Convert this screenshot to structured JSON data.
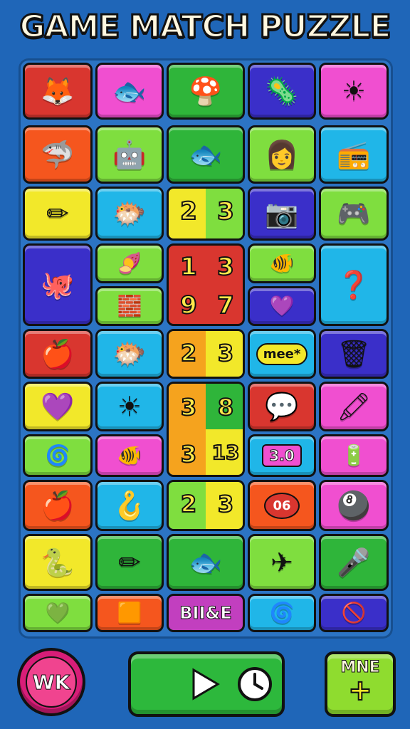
{
  "title": "GAME MATCH PUZZLE",
  "grid": {
    "tiles": [
      {
        "color": "#d9362f",
        "icon": "🦊",
        "name": "fox-icon"
      },
      {
        "color": "#f04fd0",
        "icon": "🐟",
        "name": "fish-icon"
      },
      {
        "color": "#2fb53a",
        "icon": "🍄",
        "name": "mushroom-icon"
      },
      {
        "color": "#3a2fc9",
        "icon": "🦠",
        "name": "blob-icon"
      },
      {
        "color": "#f04fd0",
        "icon": "☀",
        "name": "sun-icon"
      },
      {
        "color": "#f5561e",
        "icon": "🦈",
        "name": "shark-icon"
      },
      {
        "color": "#7fde3f",
        "icon": "🤖",
        "name": "robot-icon"
      },
      {
        "color": "#2fb53a",
        "icon": "🐟",
        "name": "fish-key-icon"
      },
      {
        "color": "#7fde3f",
        "icon": "👩",
        "name": "face-icon"
      },
      {
        "color": "#20b6e8",
        "icon": "📻",
        "name": "radio-icon"
      },
      {
        "color": "#f2e82a",
        "icon": "✏",
        "name": "pencil-icon"
      },
      {
        "color": "#20b6e8",
        "icon": "🐡",
        "name": "pufferfish-icon"
      },
      {
        "color": "#3a2fc9",
        "icon": "📷",
        "name": "camera-icon"
      },
      {
        "color": "#7fde3f",
        "icon": "🎮",
        "name": "gamepad-icon"
      },
      {
        "color": "#3a2fc9",
        "icon": "🐙",
        "name": "octopus-icon"
      },
      {
        "color": "#7fde3f",
        "icon": "🍠",
        "name": "potato-icon"
      },
      {
        "color": "#7fde3f",
        "icon": "🐠",
        "name": "fish-pink-icon"
      },
      {
        "color": "#20b6e8",
        "icon": "❓",
        "name": "question-icon"
      },
      {
        "color": "#7fde3f",
        "icon": "🧱",
        "name": "blocks-icon"
      },
      {
        "color": "#3a2fc9",
        "icon": "💜",
        "name": "star-heart-icon"
      },
      {
        "color": "#d9362f",
        "icon": "🍎",
        "name": "apple-icon"
      },
      {
        "color": "#20b6e8",
        "icon": "🐡",
        "name": "puffer-red-icon"
      },
      {
        "color": "#3a2fc9",
        "icon": "🗑",
        "name": "bin-icon"
      },
      {
        "color": "#f2e82a",
        "icon": "💜",
        "name": "heart-icon"
      },
      {
        "color": "#20b6e8",
        "icon": "☀",
        "name": "sun-face-icon"
      },
      {
        "color": "#d9362f",
        "icon": "💬",
        "name": "chat-icon"
      },
      {
        "color": "#f04fd0",
        "icon": "🖍",
        "name": "crayon-icon"
      },
      {
        "color": "#7fde3f",
        "icon": "🌀",
        "name": "swirl-icon"
      },
      {
        "color": "#f04fd0",
        "icon": "🐠",
        "name": "fish-pink2-icon"
      },
      {
        "color": "#f04fd0",
        "icon": "🔋",
        "name": "battery-icon"
      },
      {
        "color": "#f5561e",
        "icon": "🍎",
        "name": "apple-orange-icon"
      },
      {
        "color": "#20b6e8",
        "icon": "🪝",
        "name": "hook-icon"
      },
      {
        "color": "#f5561e",
        "icon": "🔴",
        "name": "oval-icon"
      },
      {
        "color": "#f04fd0",
        "icon": "🎱",
        "name": "ball-icon"
      },
      {
        "color": "#f2e82a",
        "icon": "🐍",
        "name": "worm-icon"
      },
      {
        "color": "#2fb53a",
        "icon": "✏",
        "name": "pencil-green-icon"
      },
      {
        "color": "#2fb53a",
        "icon": "🐟",
        "name": "fish-key2-icon"
      },
      {
        "color": "#7fde3f",
        "icon": "✈",
        "name": "plane-icon"
      },
      {
        "color": "#2fb53a",
        "icon": "🎤",
        "name": "mic-icon"
      },
      {
        "color": "#7fde3f",
        "icon": "💚",
        "name": "heart-green-icon"
      },
      {
        "color": "#f5561e",
        "icon": "🟧",
        "name": "square-icon"
      },
      {
        "color": "#20b6e8",
        "icon": "🌀",
        "name": "swirl-small-icon"
      },
      {
        "color": "#3a2fc9",
        "icon": "🚫",
        "name": "ban-icon"
      }
    ],
    "numtiles": {
      "row3": {
        "left": "2",
        "right": "3"
      },
      "big": {
        "tl": "1",
        "tr": "3",
        "bl": "9",
        "br": "7"
      },
      "row6": {
        "left": "2",
        "right": "3"
      },
      "tall": {
        "tl": "3",
        "tr": "8",
        "bl": "3",
        "br": "13"
      },
      "row9": {
        "left": "2",
        "right": "3"
      }
    },
    "labels": {
      "card": "mee*",
      "counter": "3.0",
      "oval": "06",
      "special": "BII&E"
    }
  },
  "buttons": {
    "left_label": "WK",
    "more_label": "MNE",
    "more_icon": "plus-icon",
    "play_icon": "play-icon",
    "clock_icon": "clock-icon"
  }
}
